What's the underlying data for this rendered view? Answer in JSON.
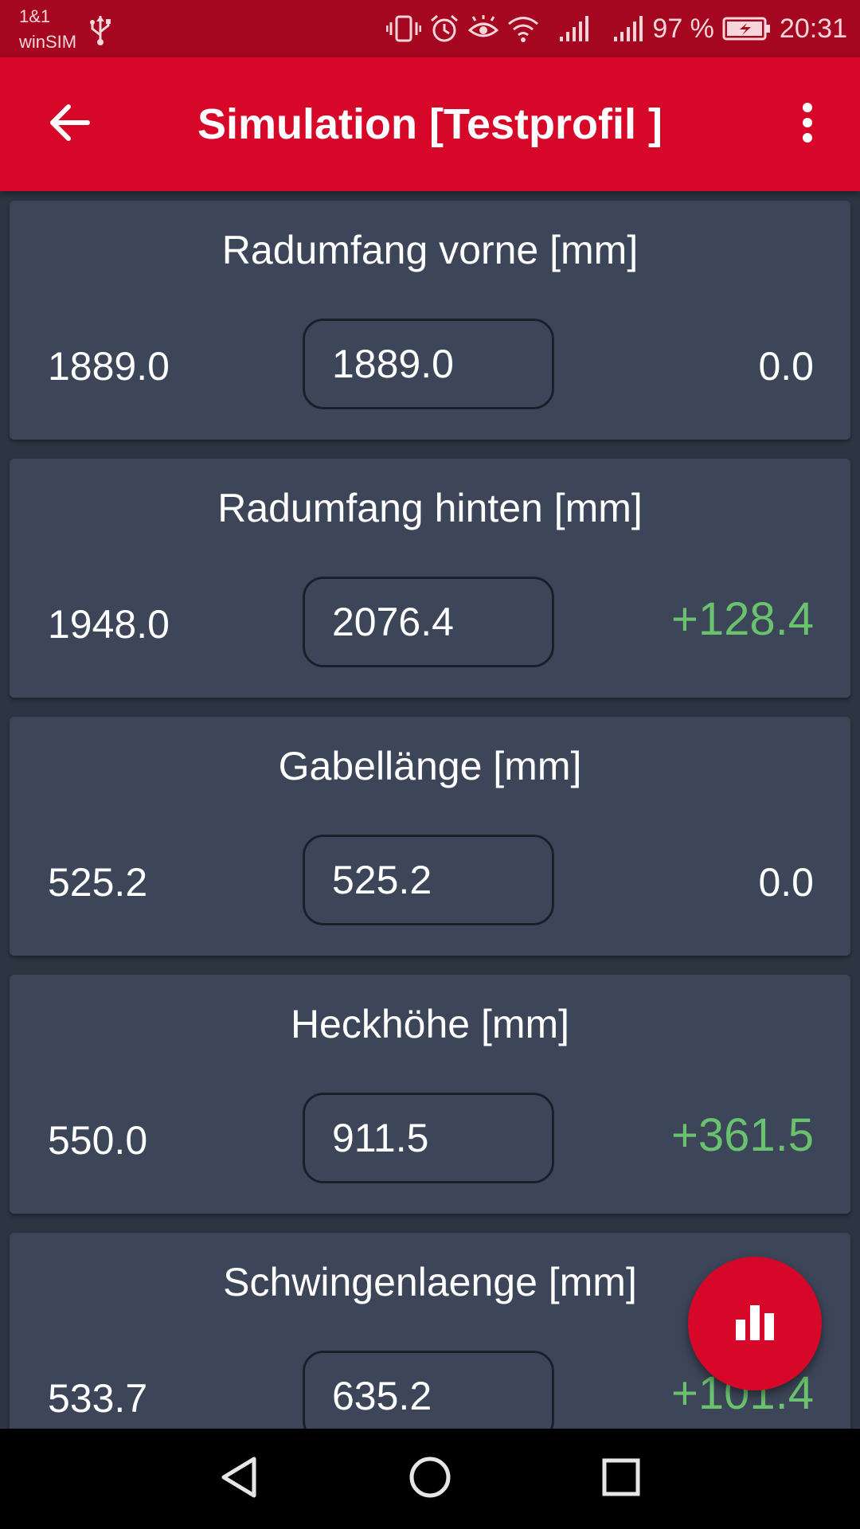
{
  "status_bar": {
    "carrier_line1": "1&1",
    "carrier_line2": "winSIM",
    "battery_percent": "97 %",
    "time": "20:31",
    "icons": [
      "usb-icon",
      "vibrate-icon",
      "alarm-icon",
      "eye-comfort-icon",
      "wifi-icon",
      "signal-icon",
      "signal-icon",
      "battery-charging-icon"
    ]
  },
  "app_bar": {
    "title": "Simulation [Testprofil ]",
    "back_icon": "arrow-back-icon",
    "menu_icon": "more-vertical-icon"
  },
  "cards": [
    {
      "title": "Radumfang vorne [mm]",
      "original": "1889.0",
      "input": "1889.0",
      "difference": "0.0"
    },
    {
      "title": "Radumfang hinten [mm]",
      "original": "1948.0",
      "input": "2076.4",
      "difference": "+128.4"
    },
    {
      "title": "Gabellänge [mm]",
      "original": "525.2",
      "input": "525.2",
      "difference": "0.0"
    },
    {
      "title": "Heckhöhe [mm]",
      "original": "550.0",
      "input": "911.5",
      "difference": "+361.5"
    },
    {
      "title": "Schwingenlaenge [mm]",
      "original": "533.7",
      "input": "635.2",
      "difference": "+101.4"
    }
  ],
  "fab": {
    "icon": "bar-chart-icon"
  },
  "nav_bar": {
    "icons": [
      "nav-back-icon",
      "nav-home-icon",
      "nav-recents-icon"
    ]
  },
  "colors": {
    "status_bar": "#a4071f",
    "app_bar": "#d7072a",
    "background": "#2d3442",
    "card": "#3d4659",
    "positive": "#6ac26e"
  }
}
